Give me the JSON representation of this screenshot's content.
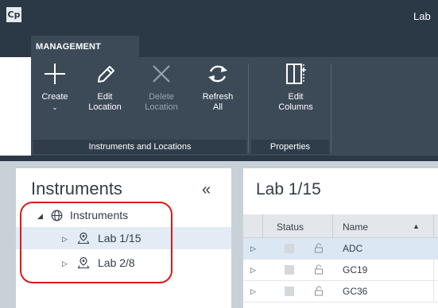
{
  "app": {
    "logo_text": "Cp",
    "window_title": "Lab"
  },
  "ribbon": {
    "tab": "MANAGEMENT",
    "buttons": {
      "create": {
        "label": "Create",
        "caret": "⌄",
        "icon": "plus-icon"
      },
      "edit_location": {
        "line1": "Edit",
        "line2": "Location",
        "icon": "pencil-icon"
      },
      "delete_location": {
        "line1": "Delete",
        "line2": "Location",
        "icon": "x-icon",
        "disabled": true
      },
      "refresh_all": {
        "line1": "Refresh",
        "line2": "All",
        "icon": "refresh-icon"
      },
      "edit_columns": {
        "line1": "Edit",
        "line2": "Columns",
        "icon": "columns-icon"
      }
    },
    "groups": {
      "instruments_locations": "Instruments and Locations",
      "properties": "Properties"
    }
  },
  "nav": {
    "title": "Instruments",
    "collapse_glyph": "«",
    "tree": {
      "root": {
        "label": "Instruments",
        "icon": "globe-icon",
        "expanded": true
      },
      "children": [
        {
          "label": "Lab 1/15",
          "icon": "location-pin-icon",
          "selected": true
        },
        {
          "label": "Lab 2/8",
          "icon": "location-pin-icon",
          "selected": false
        }
      ]
    }
  },
  "content": {
    "title": "Lab 1/15",
    "columns": {
      "status": "Status",
      "name": "Name"
    },
    "rows": [
      {
        "name": "ADC",
        "selected": true
      },
      {
        "name": "GC19",
        "selected": false
      },
      {
        "name": "GC36",
        "selected": false
      }
    ]
  },
  "colors": {
    "titlebar": "#2b3947",
    "ribbon": "#3c4a58",
    "workspace": "#c8d0d8",
    "selection": "#e3ecf5",
    "highlight_ring": "#e01818"
  }
}
